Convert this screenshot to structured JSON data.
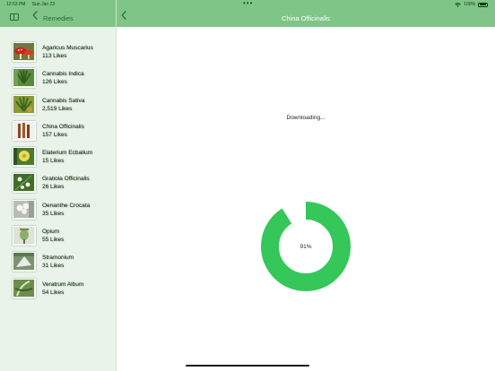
{
  "status_bar": {
    "time": "12:53 PM",
    "date": "Sun Jan 23",
    "multitask": "•••",
    "battery_text": "100%",
    "battery_level": 1.0
  },
  "sidebar": {
    "title": "Remedies",
    "items": [
      {
        "name": "Agaricus Muscarius",
        "likes": "113 Likes"
      },
      {
        "name": "Cannabis Indica",
        "likes": "126 Likes"
      },
      {
        "name": "Cannabis Sativa",
        "likes": "2,519 Likes"
      },
      {
        "name": "China Officinalis",
        "likes": "157 Likes"
      },
      {
        "name": "Elaterium Ecbalium",
        "likes": "15 Likes"
      },
      {
        "name": "Gratiola Officinalis",
        "likes": "26 Likes"
      },
      {
        "name": "Oenanthe Crocata",
        "likes": "35 Likes"
      },
      {
        "name": "Opium",
        "likes": "55 Likes"
      },
      {
        "name": "Stramonium",
        "likes": "31 Likes"
      },
      {
        "name": "Veratrum Album",
        "likes": "54 Likes"
      }
    ]
  },
  "detail": {
    "title": "China Officinalis",
    "status_text": "Downloading...",
    "progress_label": "91%",
    "progress_fraction": 0.91
  },
  "colors": {
    "accent": "#7fc588",
    "progress": "#35c759",
    "sidebar_bg": "#eaf3e9"
  },
  "icons": {
    "sidebar_toggle": "sidebar-toggle-icon",
    "back": "chevron-left-icon",
    "wifi": "wifi-icon",
    "battery": "battery-icon"
  }
}
